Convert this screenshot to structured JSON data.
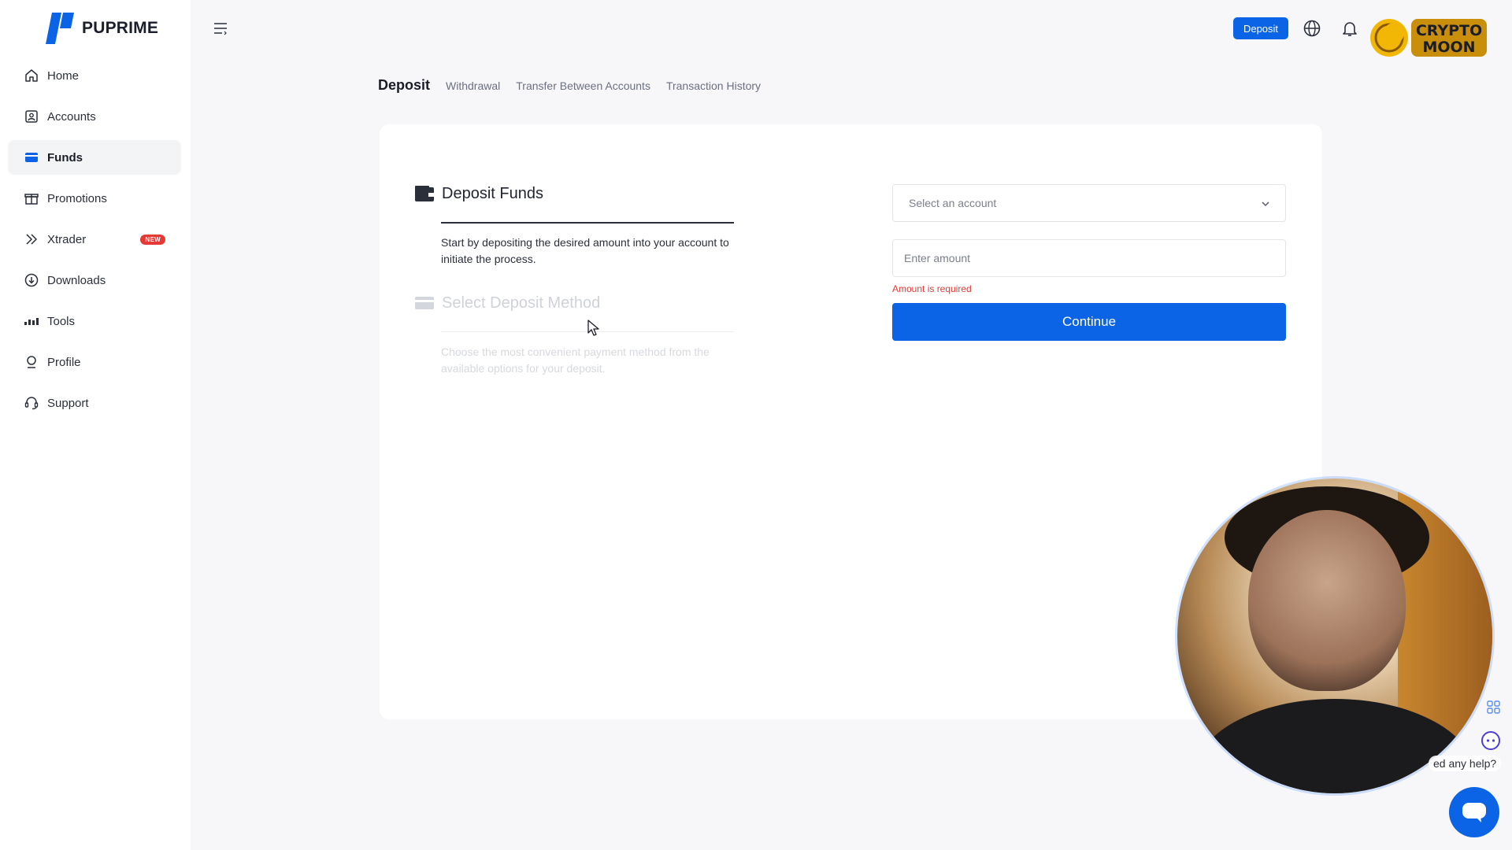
{
  "brand": {
    "name": "PUPRIME",
    "accent": "#0b63e5"
  },
  "sidebar": {
    "items": [
      {
        "label": "Home",
        "icon": "home-icon"
      },
      {
        "label": "Accounts",
        "icon": "accounts-icon"
      },
      {
        "label": "Funds",
        "icon": "wallet-icon",
        "active": true
      },
      {
        "label": "Promotions",
        "icon": "gift-icon"
      },
      {
        "label": "Xtrader",
        "icon": "chevrons-right-icon",
        "badge": "NEW"
      },
      {
        "label": "Downloads",
        "icon": "download-icon"
      },
      {
        "label": "Tools",
        "icon": "tools-icon"
      },
      {
        "label": "Profile",
        "icon": "profile-icon"
      },
      {
        "label": "Support",
        "icon": "headset-icon"
      }
    ]
  },
  "header": {
    "deposit_label": "Deposit",
    "icons": [
      "menu-icon",
      "globe-icon",
      "bell-icon"
    ],
    "avatar_text": "CRYPTO MOON"
  },
  "tabs": [
    {
      "label": "Deposit",
      "active": true
    },
    {
      "label": "Withdrawal"
    },
    {
      "label": "Transfer Between Accounts"
    },
    {
      "label": "Transaction History"
    }
  ],
  "steps": [
    {
      "title": "Deposit Funds",
      "description": "Start by depositing the desired amount into your account to initiate the process."
    },
    {
      "title": "Select Deposit Method",
      "description": "Choose the most convenient payment method from the available options for your deposit."
    }
  ],
  "form": {
    "account_placeholder": "Select an account",
    "amount_placeholder": "Enter amount",
    "amount_value": "",
    "error": "Amount is required",
    "continue_label": "Continue"
  },
  "help": {
    "text": "ed any help?"
  },
  "colors": {
    "error": "#e53935",
    "primary": "#0b63e5"
  }
}
